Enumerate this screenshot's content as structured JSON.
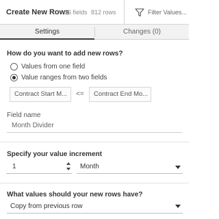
{
  "header": {
    "title": "Create New Rows",
    "fields_count": "16 fields",
    "rows_count": "812 rows",
    "filter_label": "Filter Values..."
  },
  "tabs": [
    {
      "label": "Settings",
      "active": true
    },
    {
      "label": "Changes (0)",
      "active": false
    }
  ],
  "add_rows": {
    "question": "How do you want to add new rows?",
    "options": [
      {
        "label": "Values from one field",
        "checked": false
      },
      {
        "label": "Value ranges from two fields",
        "checked": true
      }
    ],
    "start_field": "Contract Start M...",
    "operator": "<=",
    "end_field": "Contract End Mo..."
  },
  "field_name": {
    "label": "Field name",
    "value": "Month Divider"
  },
  "increment": {
    "question": "Specify your value increment",
    "value": "1",
    "unit": "Month"
  },
  "new_values": {
    "question": "What values should your new rows have?",
    "selected": "Copy from previous row"
  }
}
